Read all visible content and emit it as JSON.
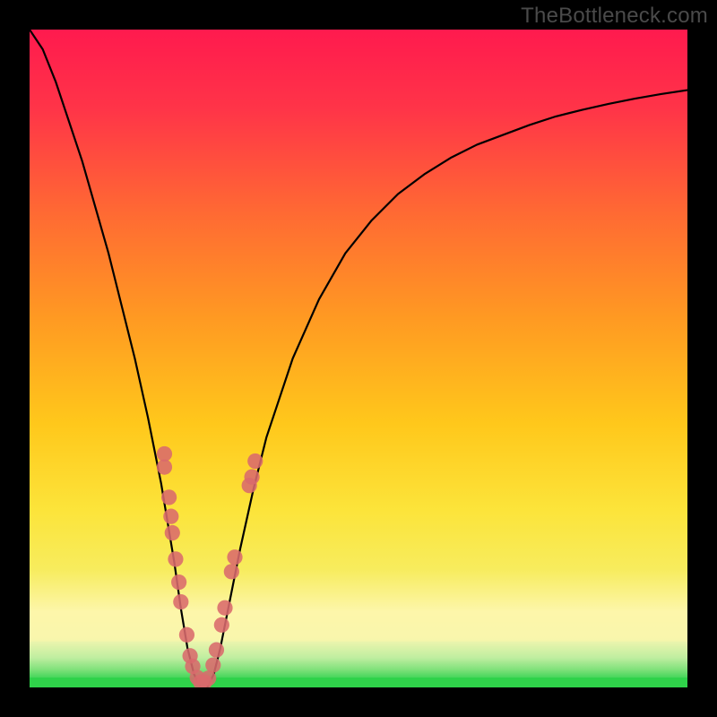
{
  "watermark": {
    "text": "TheBottleneck.com"
  },
  "colors": {
    "frame": "#000000",
    "curve": "#000000",
    "marker_fill": "#d96a6c",
    "marker_stroke": "#c75457",
    "green_band": "#2fd24a",
    "pale_band_top": "#fdf6aa",
    "pale_band_bot": "#f4f6b0"
  },
  "chart_data": {
    "type": "line",
    "title": "",
    "xlabel": "",
    "ylabel": "",
    "xlim": [
      0,
      100
    ],
    "ylim": [
      0,
      100
    ],
    "grid": false,
    "legend": false,
    "note": "No axis ticks or numeric labels are shown; x and y values are normalized 0–100 estimates from the image. Background is a vertical red→yellow→green gradient.",
    "series": [
      {
        "name": "bottleneck-curve",
        "x": [
          0,
          2,
          4,
          6,
          8,
          10,
          12,
          14,
          16,
          18,
          19,
          20,
          21,
          22,
          23,
          24,
          25,
          26,
          27,
          28,
          29,
          30,
          32,
          34,
          36,
          38,
          40,
          44,
          48,
          52,
          56,
          60,
          64,
          68,
          72,
          76,
          80,
          84,
          88,
          92,
          96,
          100
        ],
        "y": [
          100,
          97,
          92,
          86,
          80,
          73,
          66,
          58,
          50,
          41,
          36,
          31,
          25,
          19,
          12,
          6,
          2,
          0,
          0,
          2,
          6,
          11,
          21,
          30,
          38,
          44,
          50,
          59,
          66,
          71,
          75,
          78,
          80.5,
          82.5,
          84,
          85.5,
          86.8,
          87.8,
          88.7,
          89.5,
          90.2,
          90.8
        ]
      }
    ],
    "markers": [
      {
        "x": 20.5,
        "y": 35.5
      },
      {
        "x": 20.5,
        "y": 33.5
      },
      {
        "x": 21.2,
        "y": 28.9
      },
      {
        "x": 21.5,
        "y": 26.0
      },
      {
        "x": 21.7,
        "y": 23.5
      },
      {
        "x": 22.2,
        "y": 19.5
      },
      {
        "x": 22.7,
        "y": 16.0
      },
      {
        "x": 23.0,
        "y": 13.0
      },
      {
        "x": 23.9,
        "y": 8.0
      },
      {
        "x": 24.4,
        "y": 4.8
      },
      {
        "x": 24.8,
        "y": 3.2
      },
      {
        "x": 25.5,
        "y": 1.5
      },
      {
        "x": 26.0,
        "y": 0.8
      },
      {
        "x": 26.6,
        "y": 0.8
      },
      {
        "x": 27.2,
        "y": 1.4
      },
      {
        "x": 27.9,
        "y": 3.4
      },
      {
        "x": 28.4,
        "y": 5.7
      },
      {
        "x": 29.2,
        "y": 9.5
      },
      {
        "x": 29.7,
        "y": 12.1
      },
      {
        "x": 30.7,
        "y": 17.6
      },
      {
        "x": 31.2,
        "y": 19.8
      },
      {
        "x": 33.4,
        "y": 30.7
      },
      {
        "x": 33.8,
        "y": 32.0
      },
      {
        "x": 34.3,
        "y": 34.4
      }
    ],
    "gradient_stops": [
      {
        "offset": 0.0,
        "color": "#ff1a4e"
      },
      {
        "offset": 0.12,
        "color": "#ff3448"
      },
      {
        "offset": 0.28,
        "color": "#ff6a33"
      },
      {
        "offset": 0.44,
        "color": "#ff9a22"
      },
      {
        "offset": 0.6,
        "color": "#ffc81b"
      },
      {
        "offset": 0.73,
        "color": "#fce43a"
      },
      {
        "offset": 0.82,
        "color": "#f7ec5d"
      },
      {
        "offset": 0.885,
        "color": "#fdf6aa"
      },
      {
        "offset": 0.925,
        "color": "#f4f6b0"
      },
      {
        "offset": 0.955,
        "color": "#bfeea0"
      },
      {
        "offset": 0.973,
        "color": "#7fe17a"
      },
      {
        "offset": 0.985,
        "color": "#46d65b"
      },
      {
        "offset": 1.0,
        "color": "#2fd24a"
      }
    ]
  }
}
